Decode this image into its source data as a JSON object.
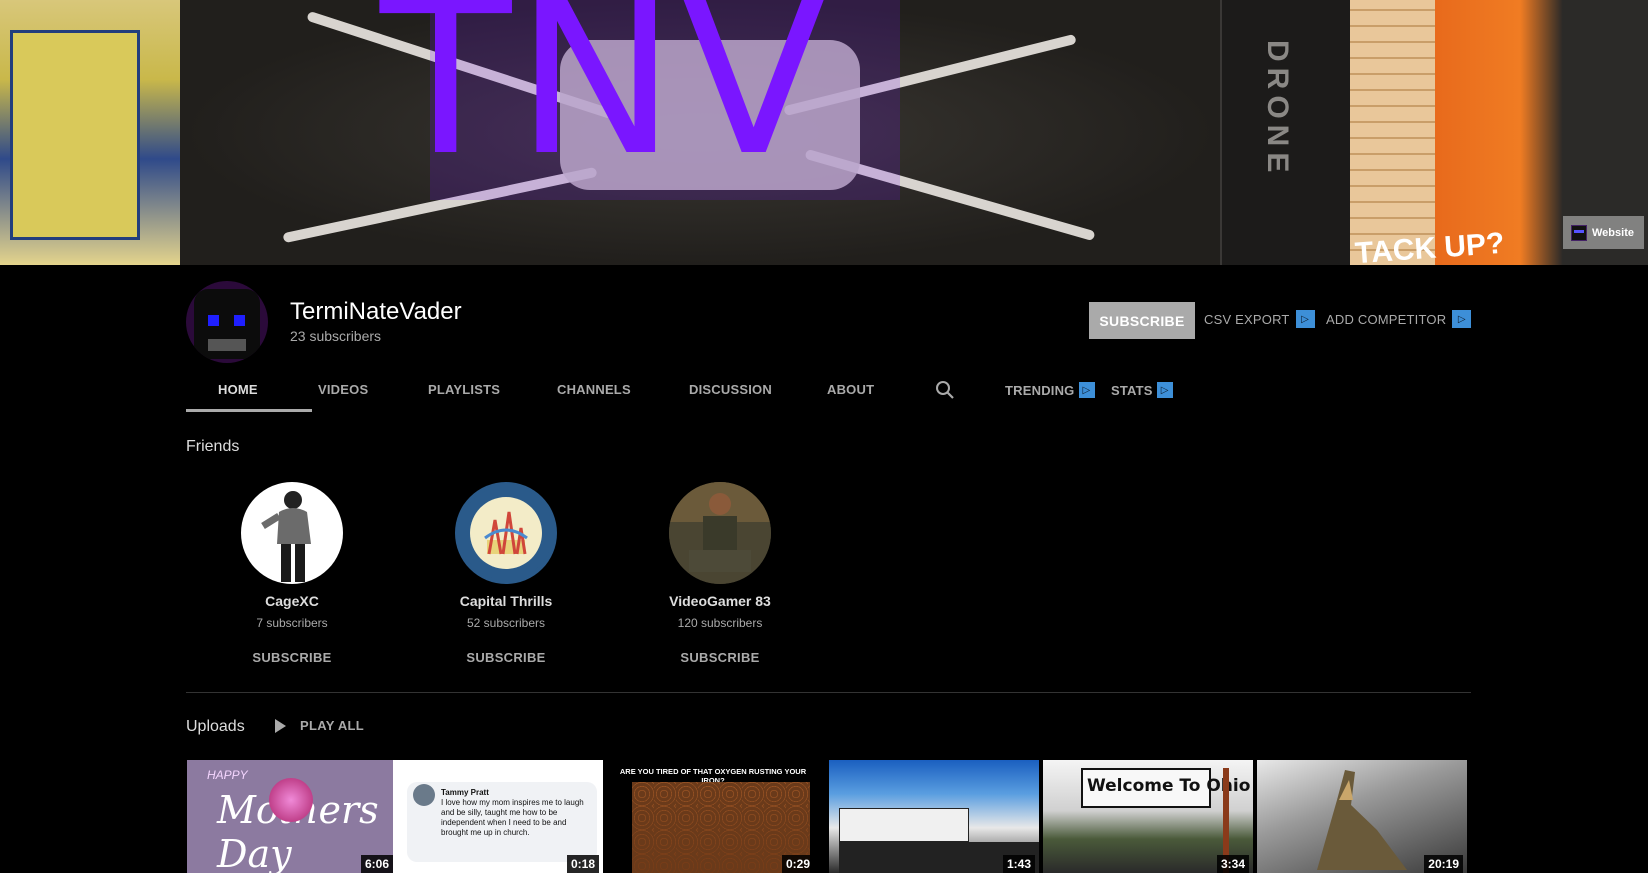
{
  "banner": {
    "logo_text": "TNV",
    "side_text": "DRONE",
    "stack_text": "TACK UP?",
    "website_label": "Website"
  },
  "channel": {
    "name": "TermiNateVader",
    "subscribers": "23 subscribers",
    "subscribe_label": "SUBSCRIBE",
    "csv_export_label": "CSV EXPORT",
    "add_competitor_label": "ADD COMPETITOR",
    "vidiq_icon_glyph": "▷"
  },
  "tabs": [
    {
      "label": "HOME",
      "active": true
    },
    {
      "label": "VIDEOS"
    },
    {
      "label": "PLAYLISTS"
    },
    {
      "label": "CHANNELS"
    },
    {
      "label": "DISCUSSION"
    },
    {
      "label": "ABOUT"
    },
    {
      "label": "TRENDING"
    },
    {
      "label": "STATS"
    }
  ],
  "friends": {
    "title": "Friends",
    "items": [
      {
        "name": "CageXC",
        "subscribers": "7 subscribers",
        "button": "SUBSCRIBE"
      },
      {
        "name": "Capital Thrills",
        "subscribers": "52 subscribers",
        "button": "SUBSCRIBE"
      },
      {
        "name": "VideoGamer 83",
        "subscribers": "120 subscribers",
        "button": "SUBSCRIBE"
      }
    ]
  },
  "uploads": {
    "title": "Uploads",
    "play_all_label": "PLAY ALL",
    "videos": [
      {
        "duration": "6:06",
        "thumb_text": "Mothers Day",
        "thumb_sub": "HAPPY"
      },
      {
        "duration": "0:18",
        "thumb_text": "Tammy Pratt",
        "thumb_sub": "I love how my mom inspires me to laugh and be silly, taught me how to be independent when I need to be and brought me up in church."
      },
      {
        "duration": "0:29",
        "thumb_text": "ARE YOU TIRED OF THAT OXYGEN RUSTING YOUR IRON?"
      },
      {
        "duration": "1:43"
      },
      {
        "duration": "3:34",
        "thumb_text": "Welcome To Ohio"
      },
      {
        "duration": "20:19"
      }
    ]
  },
  "colors": {
    "background": "#000000",
    "logo_purple": "#7a16ff",
    "muted_text": "#aaaaaa",
    "vidiq_blue": "#3d8fd8"
  }
}
